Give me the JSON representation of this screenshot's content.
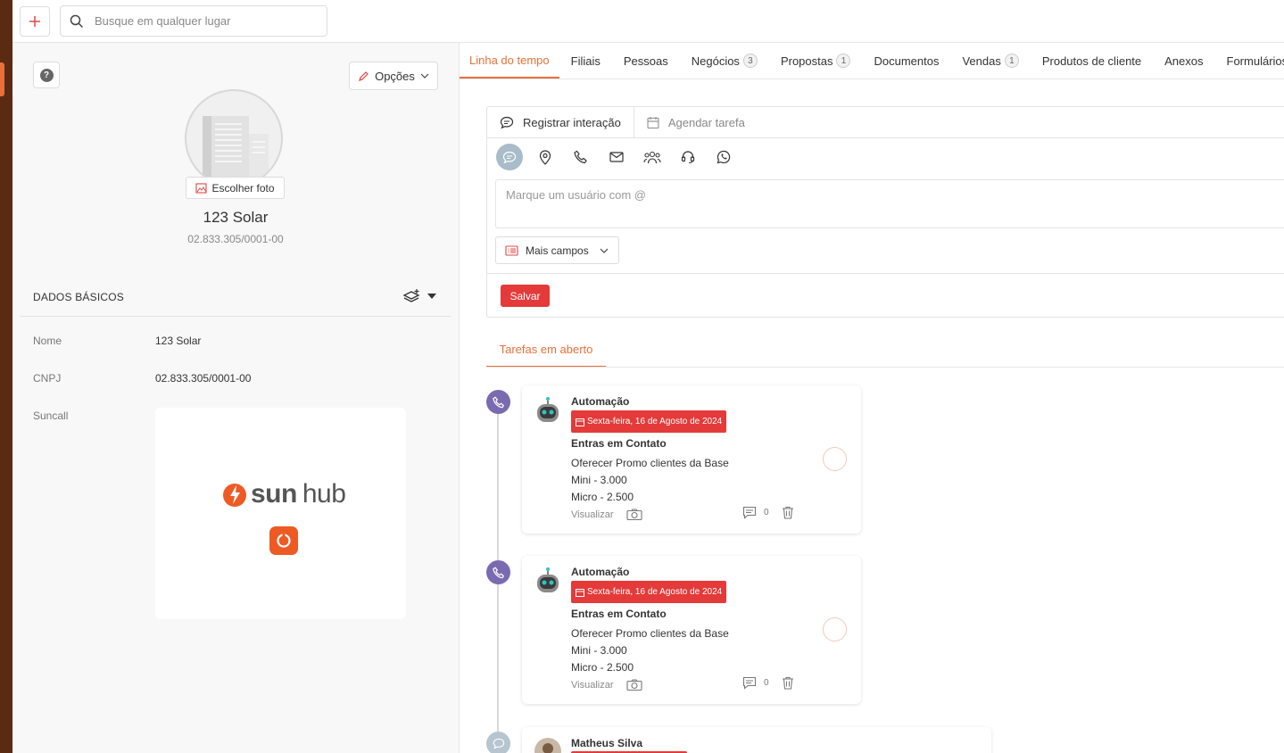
{
  "search": {
    "placeholder": "Busque em qualquer lugar"
  },
  "left_panel": {
    "options_label": "Opções",
    "choose_photo_label": "Escolher foto",
    "company_name": "123 Solar",
    "company_cnpj": "02.833.305/0001-00",
    "section_title": "DADOS BÁSICOS",
    "fields": [
      {
        "label": "Nome",
        "value": "123 Solar"
      },
      {
        "label": "CNPJ",
        "value": "02.833.305/0001-00"
      },
      {
        "label": "Suncall",
        "value": ""
      }
    ],
    "logo": {
      "sun": "sun",
      "hub": "hub"
    }
  },
  "tabs": [
    {
      "label": "Linha do tempo",
      "badge": ""
    },
    {
      "label": "Filiais",
      "badge": ""
    },
    {
      "label": "Pessoas",
      "badge": ""
    },
    {
      "label": "Negócios",
      "badge": "3"
    },
    {
      "label": "Propostas",
      "badge": "1"
    },
    {
      "label": "Documentos",
      "badge": ""
    },
    {
      "label": "Vendas",
      "badge": "1"
    },
    {
      "label": "Produtos de cliente",
      "badge": ""
    },
    {
      "label": "Anexos",
      "badge": ""
    },
    {
      "label": "Formulários externos",
      "badge": ""
    }
  ],
  "composer": {
    "tab_register": "Registrar interação",
    "tab_schedule": "Agendar tarefa",
    "note_placeholder": "Marque um usuário com @",
    "more_fields": "Mais campos",
    "save": "Salvar"
  },
  "open_tasks_label": "Tarefas em aberto",
  "tasks": [
    {
      "author": "Automação",
      "date": "Sexta-feira, 16 de Agosto de 2024",
      "title": "Entras em Contato",
      "lines": [
        "Oferecer Promo clientes da Base",
        "Mini - 3.000",
        "Micro - 2.500"
      ],
      "view": "Visualizar",
      "comments": "0"
    },
    {
      "author": "Automação",
      "date": "Sexta-feira, 16 de Agosto de 2024",
      "title": "Entras em Contato",
      "lines": [
        "Oferecer Promo clientes da Base",
        "Mini - 3.000",
        "Micro - 2.500"
      ],
      "view": "Visualizar",
      "comments": "0"
    }
  ],
  "third_item": {
    "author": "Matheus Silva"
  },
  "colors": {
    "accent": "#e8703a",
    "danger": "#e43a3a",
    "timeline_dot": "#7a6ab0"
  }
}
